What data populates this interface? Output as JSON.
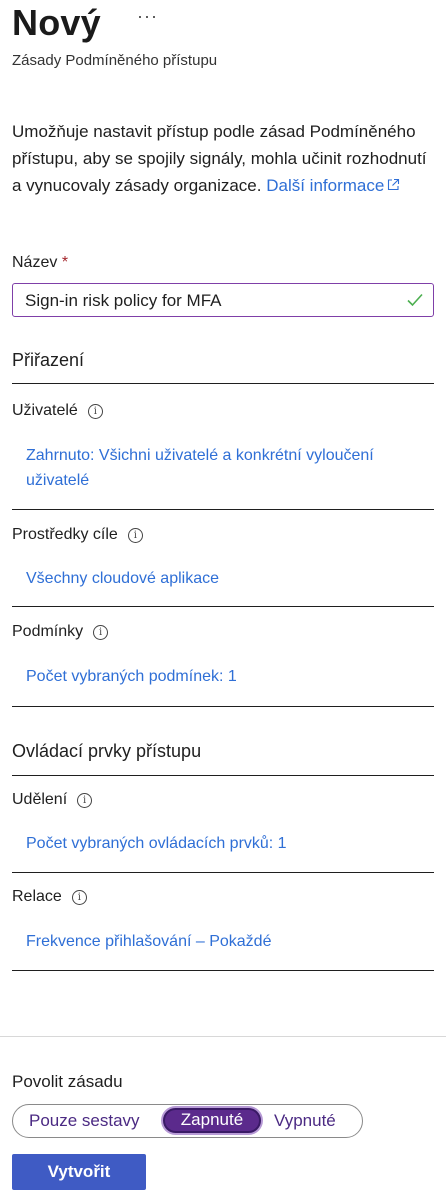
{
  "header": {
    "title": "Nový",
    "more": "···",
    "subtitle": "Zásady Podmíněného přístupu"
  },
  "description": {
    "text": "Umožňuje nastavit přístup podle zásad Podmíněného přístupu, aby se spojily signály, mohla učinit rozhodnutí a vynucovaly zásady organizace.",
    "link": "Další informace"
  },
  "name_field": {
    "label": "Název",
    "required": "*",
    "value": "Sign-in risk policy for MFA"
  },
  "assignments": {
    "heading": "Přiřazení",
    "users": {
      "label": "Uživatelé",
      "value": "Zahrnuto: Všichni uživatelé a konkrétní vyloučení uživatelé"
    },
    "targets": {
      "label": "Prostředky cíle",
      "value": "Všechny cloudové aplikace"
    },
    "conditions": {
      "label": "Podmínky",
      "value": "Počet vybraných podmínek: 1"
    }
  },
  "access_controls": {
    "heading": "Ovládací prvky přístupu",
    "grant": {
      "label": "Udělení",
      "value": "Počet vybraných ovládacích prvků: 1"
    },
    "session": {
      "label": "Relace",
      "value": "Frekvence přihlašování – Pokaždé"
    }
  },
  "enable_policy": {
    "label": "Povolit zásadu",
    "options": [
      "Pouze sestavy",
      "Zapnuté",
      "Vypnuté"
    ],
    "selected": "Zapnuté"
  },
  "create_button": "Vytvořit",
  "colors": {
    "link": "#2f6fd6",
    "accent": "#5b2a8c",
    "button": "#3f5bc4",
    "valid": "#4caf50"
  }
}
